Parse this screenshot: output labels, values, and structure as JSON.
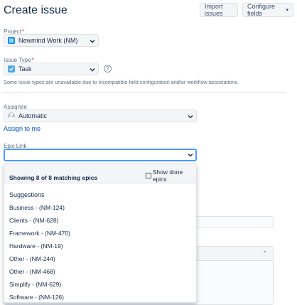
{
  "header": {
    "title": "Create issue",
    "import_label": "Import issues",
    "configure_label": "Configure fields"
  },
  "project": {
    "label": "Project",
    "required_mark": "*",
    "value": "Newmind Work (NM)"
  },
  "issue_type": {
    "label": "Issue Type",
    "required_mark": "*",
    "value": "Task",
    "help_glyph": "?",
    "note": "Some issue types are unavailable due to incompatible field configuration and/or workflow associations."
  },
  "assignee": {
    "label": "Assignee",
    "value": "Automatic",
    "assign_to_me": "Assign to me"
  },
  "epic_link": {
    "label": "Epic Link",
    "value": ""
  },
  "dropdown": {
    "count_text": "Showing 8 of 8 matching epics",
    "show_done_label": "Show done epics",
    "section_title": "Suggestions",
    "items": [
      "Business - (NM-124)",
      "Clients - (NM-628)",
      "Framework - (NM-470)",
      "Hardware - (NM-19)",
      "Other - (NM-244)",
      "Other - (NM-468)",
      "Simplify - (NM-629)",
      "Software - (NM-126)"
    ]
  },
  "colors": {
    "accent": "#0052cc",
    "focus": "#4c9aff",
    "required": "#de350b"
  }
}
